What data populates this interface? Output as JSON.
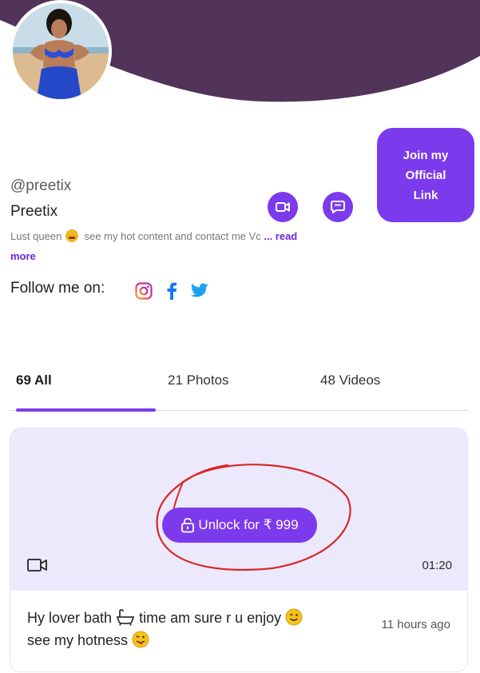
{
  "header": {
    "bg_color": "#52335a"
  },
  "profile": {
    "username": "@preetix",
    "display_name": "Preetix",
    "bio": "Lust queen",
    "bio_rest": "see my hot content and contact me Vc",
    "read_more": "... read more",
    "join_button": "Join my Official Link"
  },
  "follow": {
    "label": "Follow me on:",
    "icons": [
      "instagram-icon",
      "facebook-icon",
      "twitter-icon"
    ]
  },
  "tabs": [
    {
      "label": "69 All",
      "active": true
    },
    {
      "label": "21 Photos",
      "active": false
    },
    {
      "label": "48 Videos",
      "active": false
    }
  ],
  "post": {
    "unlock_label": "Unlock for ₹ 999",
    "duration": "01:20",
    "text_part1": "Hy lover bath",
    "text_part2": "time am sure r u enjoy",
    "text_part3": "see my hotness",
    "time_ago": "11 hours ago"
  },
  "colors": {
    "accent": "#7c3aed",
    "media_bg": "#ece9fd",
    "annotation": "#d62828"
  }
}
